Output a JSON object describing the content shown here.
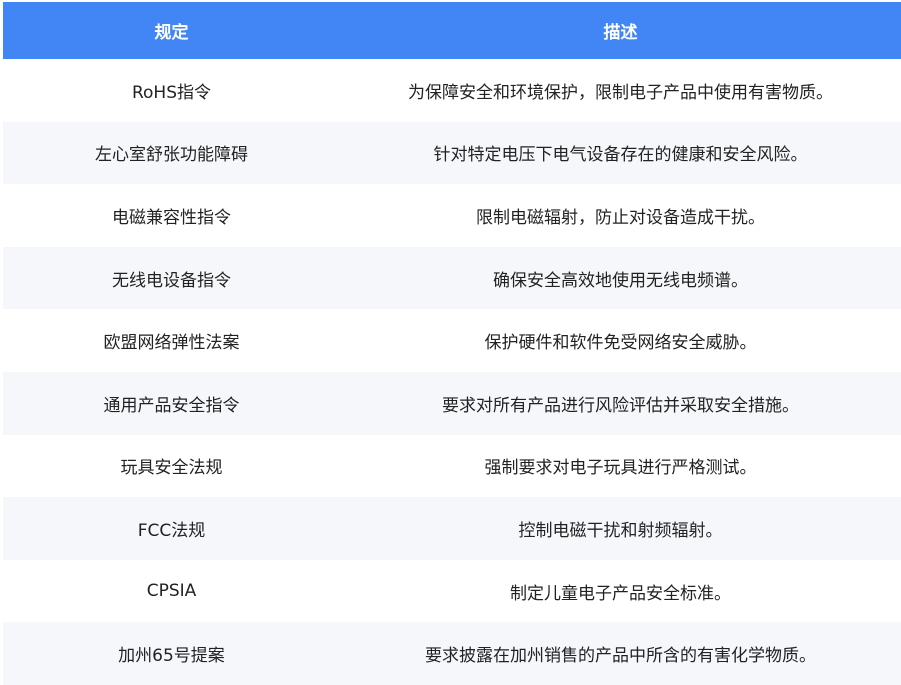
{
  "table": {
    "header": {
      "col1": "规定",
      "col2": "描述"
    },
    "rows": [
      {
        "regulation": "RoHS指令",
        "description": "为保障安全和环境保护，限制电子产品中使用有害物质。"
      },
      {
        "regulation": "左心室舒张功能障碍",
        "description": "针对特定电压下电气设备存在的健康和安全风险。"
      },
      {
        "regulation": "电磁兼容性指令",
        "description": "限制电磁辐射，防止对设备造成干扰。"
      },
      {
        "regulation": "无线电设备指令",
        "description": "确保安全高效地使用无线电频谱。"
      },
      {
        "regulation": "欧盟网络弹性法案",
        "description": "保护硬件和软件免受网络安全威胁。"
      },
      {
        "regulation": "通用产品安全指令",
        "description": "要求对所有产品进行风险评估并采取安全措施。"
      },
      {
        "regulation": "玩具安全法规",
        "description": "强制要求对电子玩具进行严格测试。"
      },
      {
        "regulation": "FCC法规",
        "description": "控制电磁干扰和射频辐射。"
      },
      {
        "regulation": "CPSIA",
        "description": "制定儿童电子产品安全标准。"
      },
      {
        "regulation": "加州65号提案",
        "description": "要求披露在加州销售的产品中所含的有害化学物质。"
      }
    ]
  }
}
